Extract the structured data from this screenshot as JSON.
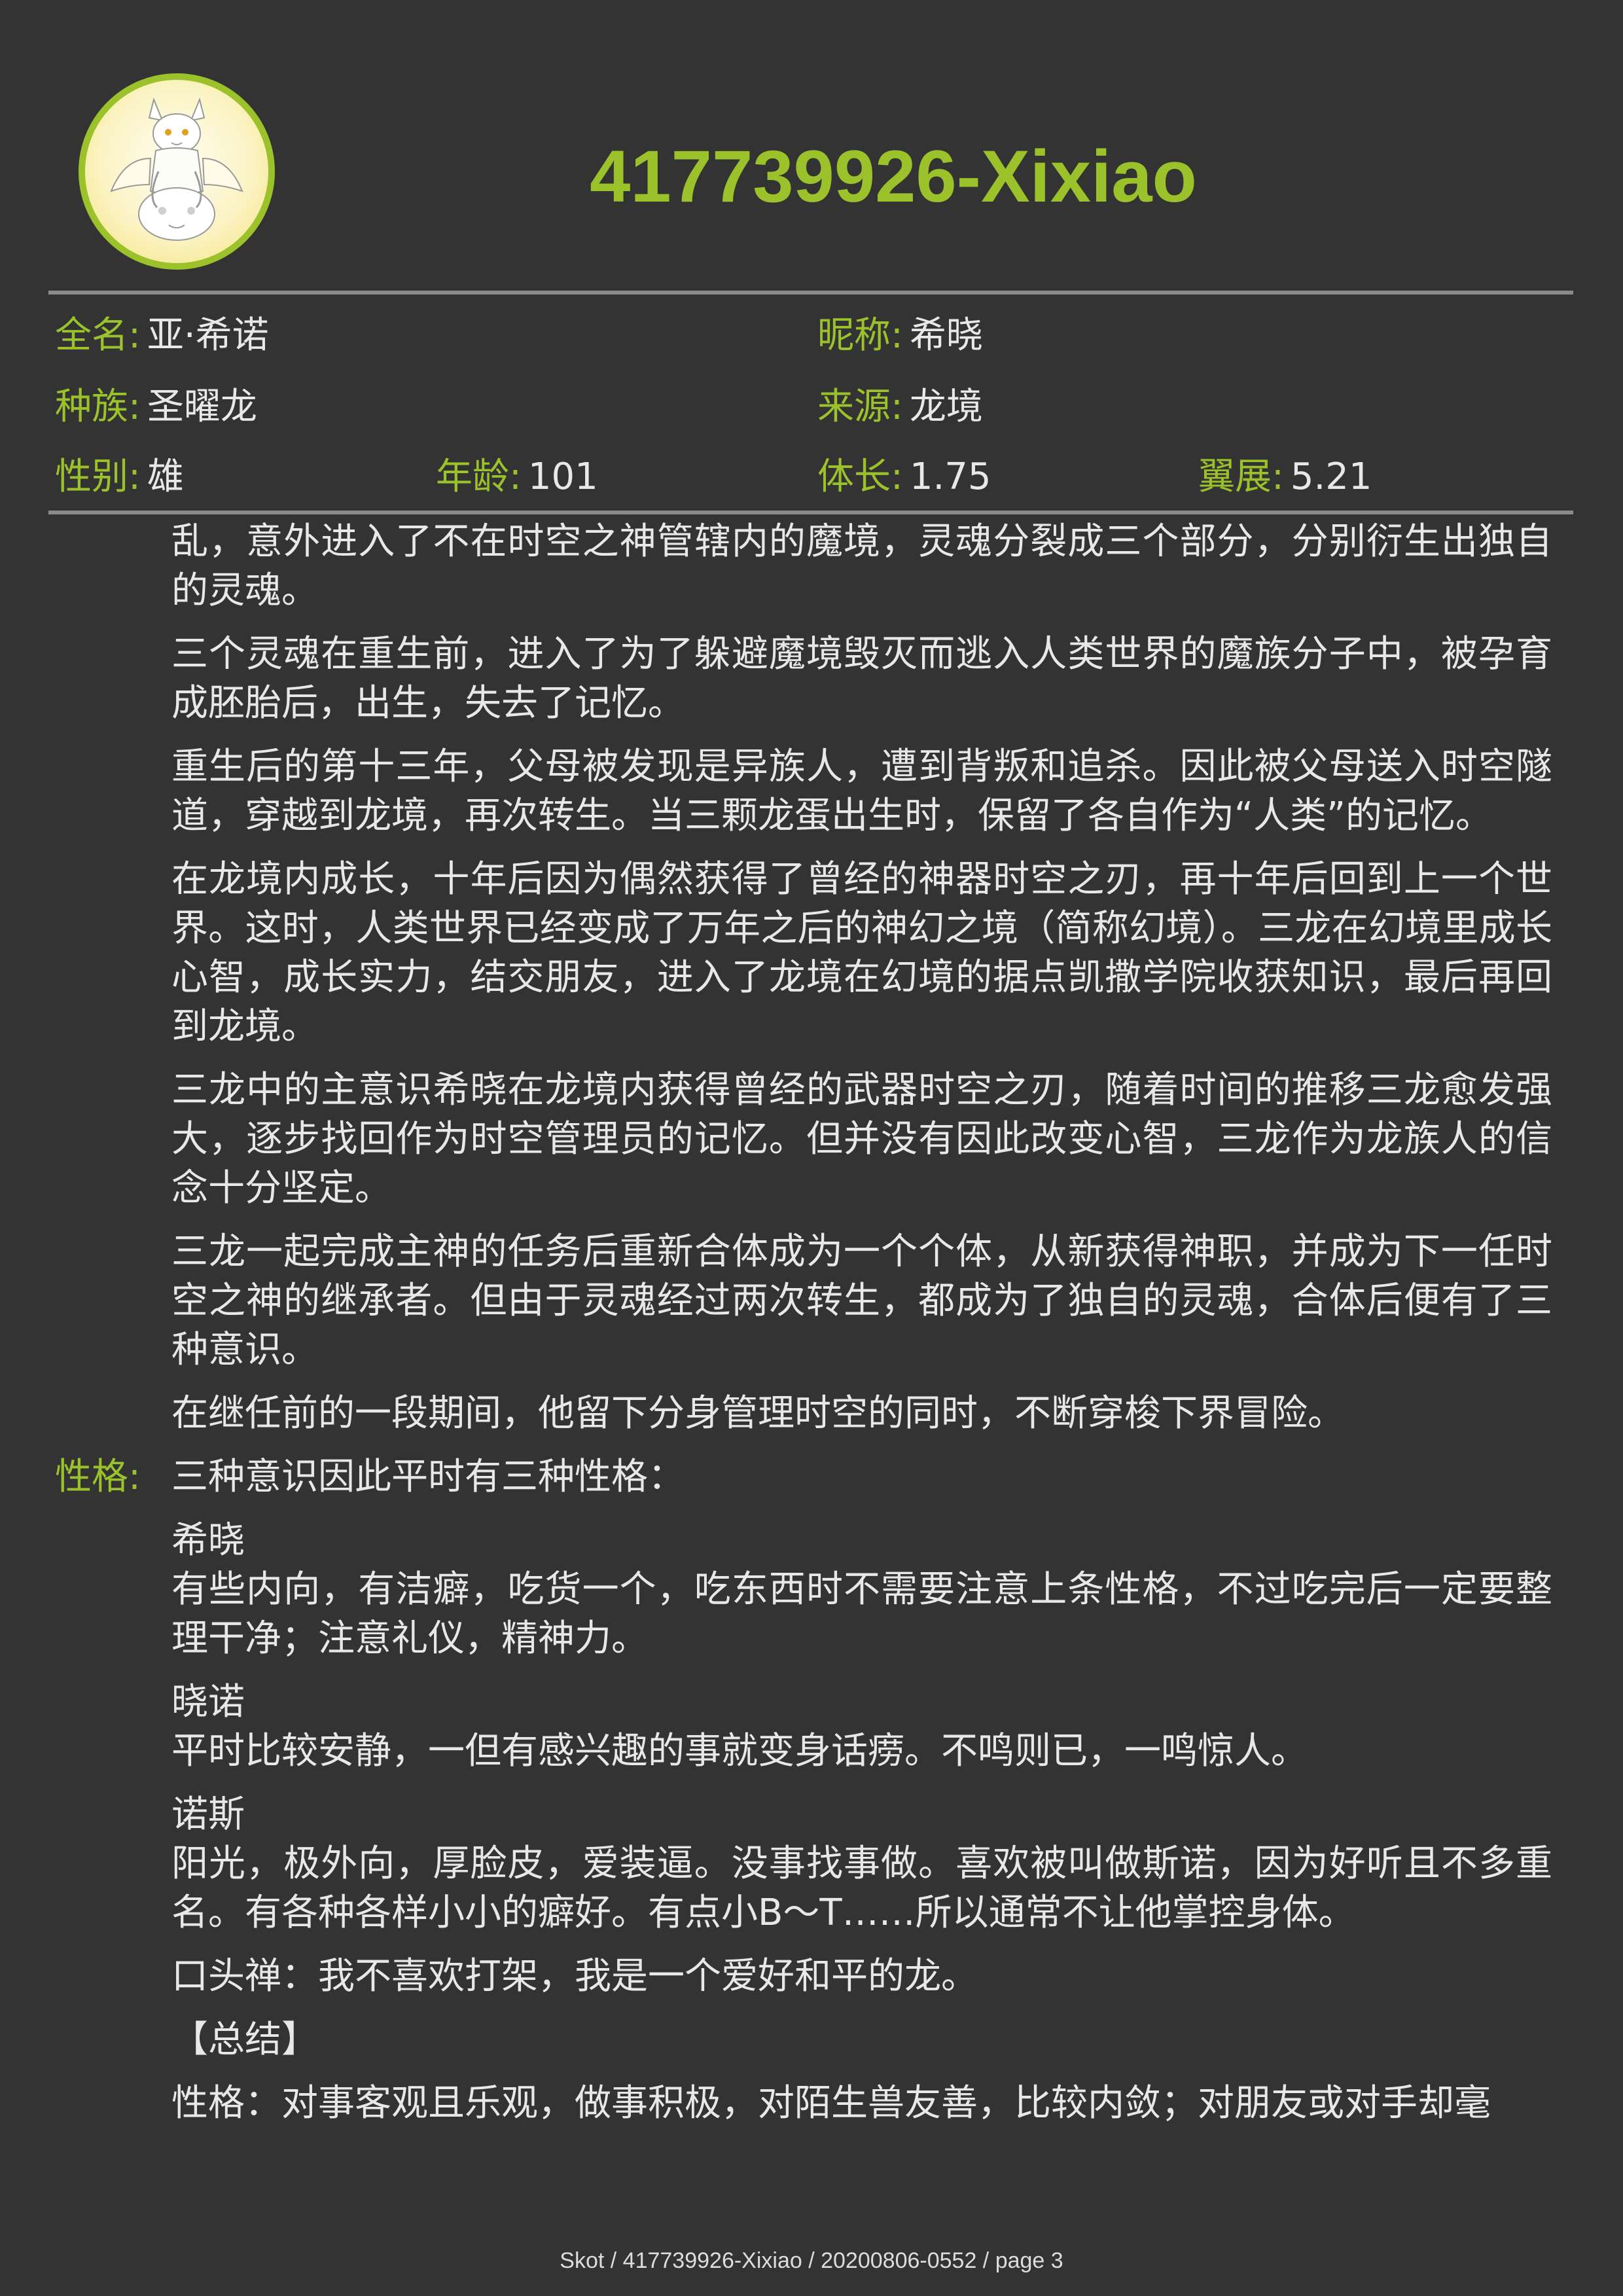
{
  "header": {
    "title": "417739926-Xixiao",
    "avatar_icon": "white-dragon-portrait"
  },
  "info": {
    "row1": [
      {
        "label": "全名:",
        "value": "亚·希诺"
      },
      {
        "label": "昵称:",
        "value": "希晓"
      }
    ],
    "row2": [
      {
        "label": "种族:",
        "value": "圣曜龙"
      },
      {
        "label": "来源:",
        "value": "龙境"
      }
    ],
    "row3": [
      {
        "label": "性别:",
        "value": "雄"
      },
      {
        "label": "年龄:",
        "value": "101"
      },
      {
        "label": "体长:",
        "value": "1.75"
      },
      {
        "label": "翼展:",
        "value": "5.21"
      }
    ]
  },
  "story": [
    "乱，意外进入了不在时空之神管辖内的魔境，灵魂分裂成三个部分，分别衍生出独自的灵魂。",
    "三个灵魂在重生前，进入了为了躲避魔境毁灭而逃入人类世界的魔族分子中，被孕育成胚胎后，出生，失去了记忆。",
    "重生后的第十三年，父母被发现是异族人，遭到背叛和追杀。因此被父母送入时空隧道，穿越到龙境，再次转生。当三颗龙蛋出生时，保留了各自作为“人类”的记忆。",
    "在龙境内成长，十年后因为偶然获得了曾经的神器时空之刃，再十年后回到上一个世界。这时，人类世界已经变成了万年之后的神幻之境（简称幻境）。三龙在幻境里成长心智，成长实力，结交朋友，进入了龙境在幻境的据点凯撒学院收获知识，最后再回到龙境。",
    "三龙中的主意识希晓在龙境内获得曾经的武器时空之刃，随着时间的推移三龙愈发强大，逐步找回作为时空管理员的记忆。但并没有因此改变心智，三龙作为龙族人的信念十分坚定。",
    "三龙一起完成主神的任务后重新合体成为一个个体，从新获得神职，并成为下一任时空之神的继承者。但由于灵魂经过两次转生，都成为了独自的灵魂，合体后便有了三种意识。",
    "在继任前的一段期间，他留下分身管理时空的同时，不断穿梭下界冒险。"
  ],
  "personality": {
    "label": "性格:",
    "intro": "三种意识因此平时有三种性格：",
    "entries": [
      {
        "name": "希晓",
        "desc": "有些内向，有洁癖，吃货一个，吃东西时不需要注意上条性格，不过吃完后一定要整理干净；注意礼仪，精神力。"
      },
      {
        "name": "晓诺",
        "desc": "平时比较安静，一但有感兴趣的事就变身话痨。不鸣则已，一鸣惊人。"
      },
      {
        "name": "诺斯",
        "desc": "阳光，极外向，厚脸皮，爱装逼。没事找事做。喜欢被叫做斯诺，因为好听且不多重名。有各种各样小小的癖好。有点小B～T……所以通常不让他掌控身体。"
      }
    ],
    "catchphrase": "口头禅：我不喜欢打架，我是一个爱好和平的龙。",
    "summary_heading": "【总结】",
    "summary": "性格：对事客观且乐观，做事积极，对陌生兽友善，比较内敛；对朋友或对手却毫"
  },
  "footer": "Skot / 417739926-Xixiao / 20200806-0552 / page 3",
  "colors": {
    "background": "#333333",
    "accent": "#9bc22a",
    "text": "#e8e8e8",
    "rule": "#8a8a8a"
  }
}
